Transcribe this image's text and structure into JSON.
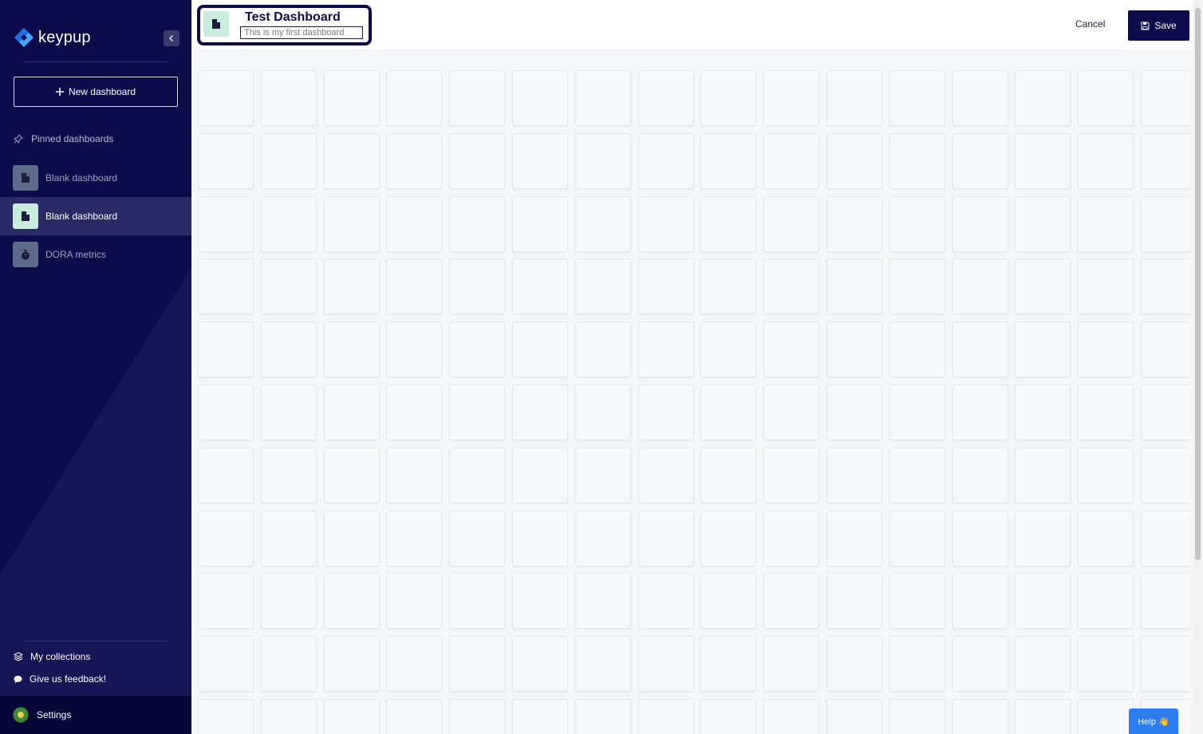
{
  "app": {
    "logo_text": "keypup"
  },
  "sidebar": {
    "new_dashboard_label": "New dashboard",
    "pinned_title": "Pinned dashboards",
    "items": [
      {
        "label": "Blank dashboard",
        "icon": "document-icon",
        "active": false
      },
      {
        "label": "Blank dashboard",
        "icon": "document-icon",
        "active": true
      },
      {
        "label": "DORA metrics",
        "icon": "stopwatch-icon",
        "active": false
      }
    ],
    "collections_label": "My collections",
    "feedback_label": "Give us feedback!",
    "settings_label": "Settings"
  },
  "header": {
    "title": "Test Dashboard",
    "description": "This is my first dashboard",
    "cancel_label": "Cancel",
    "save_label": "Save"
  },
  "help": {
    "label": "Help 👋"
  },
  "colors": {
    "sidebar_bg": "#0d0c4a",
    "accent_blue": "#2e7df0",
    "icon_mint": "#c9ecdf"
  }
}
